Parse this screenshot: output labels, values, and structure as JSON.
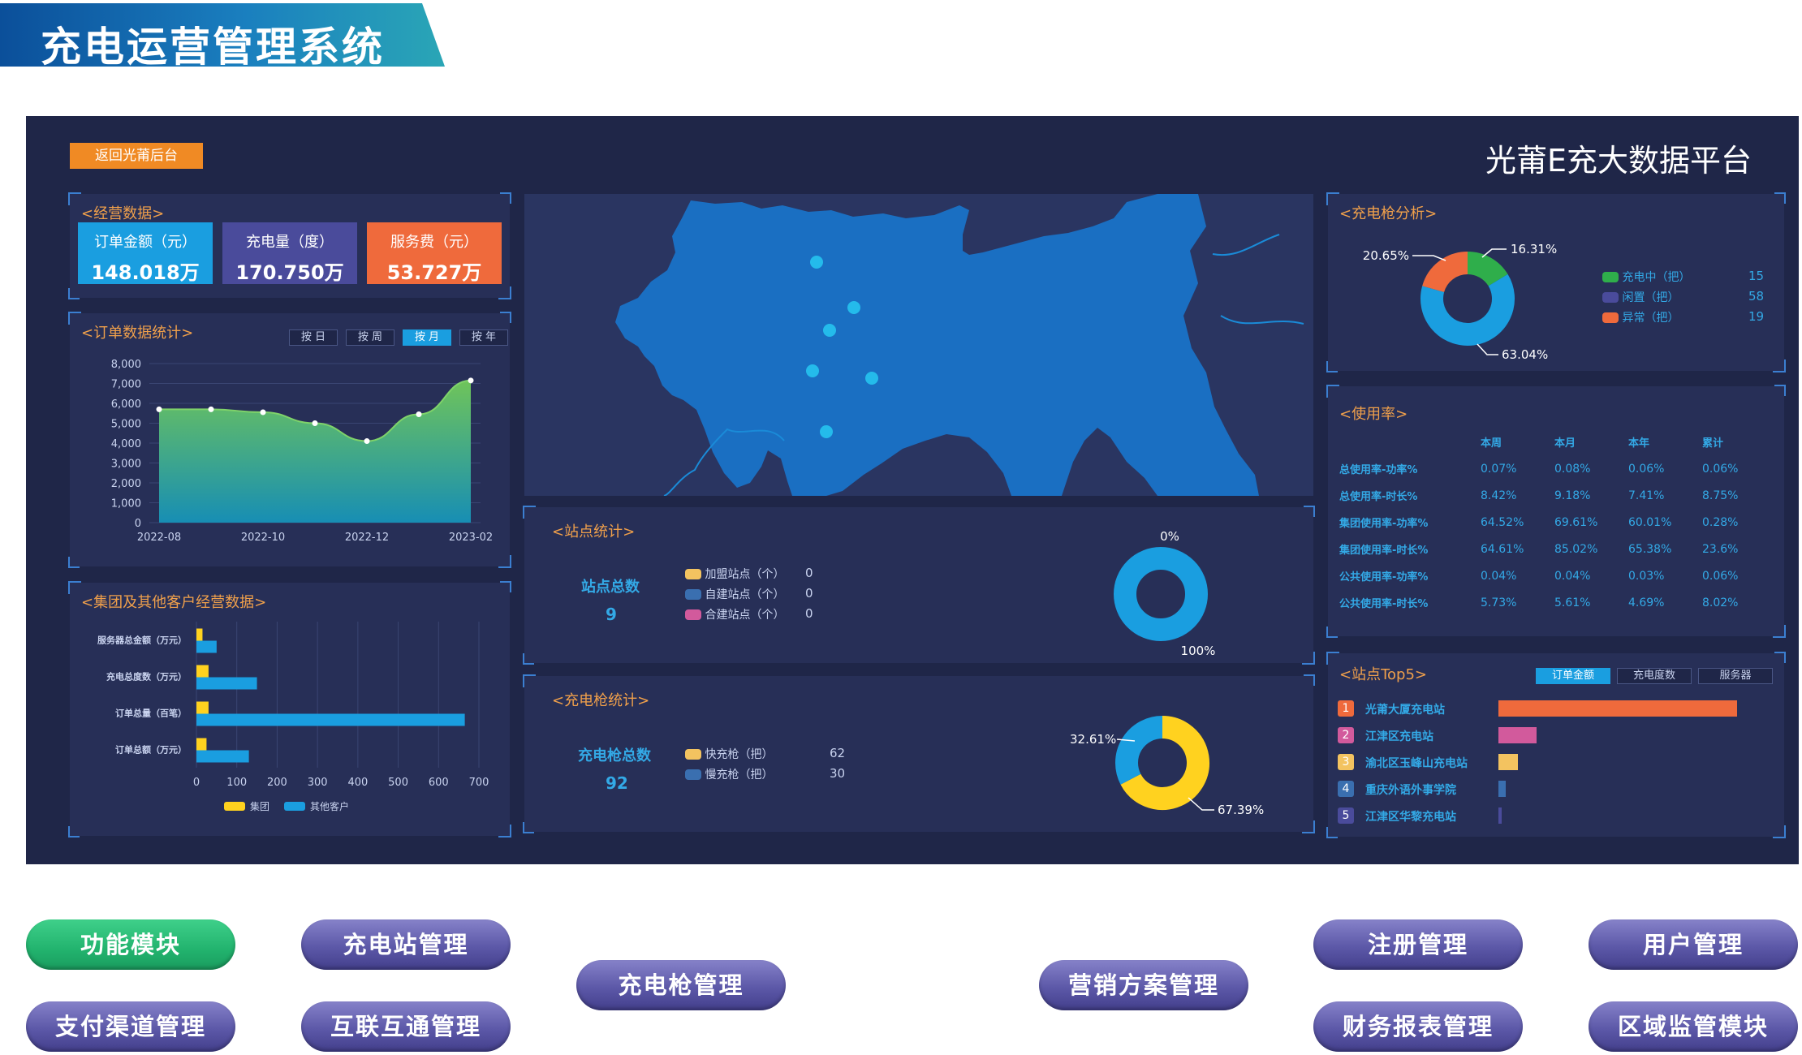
{
  "header": {
    "title": "充电运营管理系统"
  },
  "dashboard": {
    "back_label": "返回光莆后台",
    "platform_title": "光莆E充大数据平台",
    "business": {
      "title": "<经营数据>",
      "stats": [
        {
          "label": "订单金额（元）",
          "value": "148.018万",
          "color": "#1a9ee0"
        },
        {
          "label": "充电量（度）",
          "value": "170.750万",
          "color": "#4a4b9b"
        },
        {
          "label": "服务费（元）",
          "value": "53.727万",
          "color": "#ef6a3c"
        }
      ]
    },
    "order_stats": {
      "title": "<订单数据统计>",
      "tabs": [
        "按 日",
        "按 周",
        "按 月",
        "按 年"
      ],
      "active_tab": 2,
      "chart_data": {
        "type": "area",
        "x": [
          "2022-08",
          "2022-09",
          "2022-10",
          "2022-11",
          "2022-12",
          "2023-01",
          "2023-02"
        ],
        "values": [
          5700,
          5700,
          5550,
          5000,
          4100,
          5450,
          7150
        ],
        "x_tick_labels": [
          "2022-08",
          "2022-10",
          "2022-12",
          "2023-02"
        ],
        "y_ticks": [
          "8,000",
          "7,000",
          "6,000",
          "5,000",
          "4,000",
          "3,000",
          "2,000",
          "1,000",
          "0"
        ],
        "ylim": [
          0,
          8000
        ],
        "grid": true
      }
    },
    "group_stats": {
      "title": "<集团及其他客户经营数据>",
      "chart_data": {
        "type": "bar",
        "orientation": "horizontal",
        "categories": [
          "服务器总金额（万元）",
          "充电总度数（万元）",
          "订单总量（百笔）",
          "订单总额（万元）"
        ],
        "series": [
          {
            "name": "集团",
            "values": [
              15,
              30,
              30,
              25
            ],
            "color": "#ffd21f"
          },
          {
            "name": "其他客户",
            "values": [
              50,
              150,
              665,
              130
            ],
            "color": "#1a9ee0"
          }
        ],
        "x_ticks": [
          "0",
          "100",
          "200",
          "300",
          "400",
          "500",
          "600",
          "700"
        ],
        "xlim": [
          0,
          700
        ],
        "legend": "bottom"
      }
    },
    "map": {
      "points": 6
    },
    "station_stats": {
      "title": "<站点统计>",
      "total_label": "站点总数",
      "total_value": "9",
      "legend": [
        {
          "label": "加盟站点（个）",
          "value": "0",
          "color": "#f3c360"
        },
        {
          "label": "自建站点（个）",
          "value": "0",
          "color": "#3a6fb0"
        },
        {
          "label": "合建站点（个）",
          "value": "0",
          "color": "#d25a9c"
        }
      ],
      "chart_data": {
        "type": "pie",
        "labels": [
          "0%",
          "100%"
        ],
        "values": [
          0,
          100
        ],
        "colors": [
          "#ffd21f",
          "#1a9ee0"
        ]
      }
    },
    "gun_stats": {
      "title": "<充电枪统计>",
      "total_label": "充电枪总数",
      "total_value": "92",
      "legend": [
        {
          "label": "快充枪（把）",
          "value": "62",
          "color": "#f3c360"
        },
        {
          "label": "慢充枪（把）",
          "value": "30",
          "color": "#3a6fb0"
        }
      ],
      "chart_data": {
        "type": "pie",
        "labels": [
          "32.61%",
          "67.39%"
        ],
        "values": [
          32.61,
          67.39
        ],
        "colors": [
          "#1a9ee0",
          "#ffd21f"
        ]
      }
    },
    "gun_analysis": {
      "title": "<充电枪分析>",
      "legend": [
        {
          "label": "充电中（把）",
          "value": "15",
          "color": "#2fae4b"
        },
        {
          "label": "闲置（把）",
          "value": "58",
          "color": "#4a4b9b"
        },
        {
          "label": "异常（把）",
          "value": "19",
          "color": "#ef6a3c"
        }
      ],
      "chart_data": {
        "type": "pie",
        "labels": [
          "16.31%",
          "63.04%",
          "20.65%"
        ],
        "values": [
          16.31,
          63.04,
          20.65
        ],
        "colors": [
          "#2fae4b",
          "#1a9ee0",
          "#ef6a3c"
        ]
      }
    },
    "usage": {
      "title": "<使用率>",
      "columns": [
        "本周",
        "本月",
        "本年",
        "累计"
      ],
      "rows": [
        {
          "label": "总使用率-功率%",
          "values": [
            "0.07%",
            "0.08%",
            "0.06%",
            "0.06%"
          ]
        },
        {
          "label": "总使用率-时长%",
          "values": [
            "8.42%",
            "9.18%",
            "7.41%",
            "8.75%"
          ]
        },
        {
          "label": "集团使用率-功率%",
          "values": [
            "64.52%",
            "69.61%",
            "60.01%",
            "0.28%"
          ]
        },
        {
          "label": "集团使用率-时长%",
          "values": [
            "64.61%",
            "85.02%",
            "65.38%",
            "23.6%"
          ]
        },
        {
          "label": "公共使用率-功率%",
          "values": [
            "0.04%",
            "0.04%",
            "0.03%",
            "0.06%"
          ]
        },
        {
          "label": "公共使用率-时长%",
          "values": [
            "5.73%",
            "5.61%",
            "4.69%",
            "8.02%"
          ]
        }
      ]
    },
    "top5": {
      "title": "<站点Top5>",
      "tabs": [
        "订单金额",
        "充电度数",
        "服务器"
      ],
      "active_tab": 0,
      "items": [
        {
          "rank": "1",
          "name": "光莆大厦充电站",
          "color": "#ef6a3c",
          "value": 1.0
        },
        {
          "rank": "2",
          "name": "江津区充电站",
          "color": "#d25a9c",
          "value": 0.16
        },
        {
          "rank": "3",
          "name": "渝北区玉峰山充电站",
          "color": "#f3c360",
          "value": 0.08
        },
        {
          "rank": "4",
          "name": "重庆外语外事学院",
          "color": "#3a6fb0",
          "value": 0.03
        },
        {
          "rank": "5",
          "name": "江津区华黎充电站",
          "color": "#4a4b9b",
          "value": 0.01
        }
      ]
    }
  },
  "modules": {
    "function_label": "功能模块",
    "buttons": [
      "充电站管理",
      "充电枪管理",
      "营销方案管理",
      "注册管理",
      "用户管理",
      "支付渠道管理",
      "互联互通管理",
      "财务报表管理",
      "区域监管模块"
    ]
  }
}
